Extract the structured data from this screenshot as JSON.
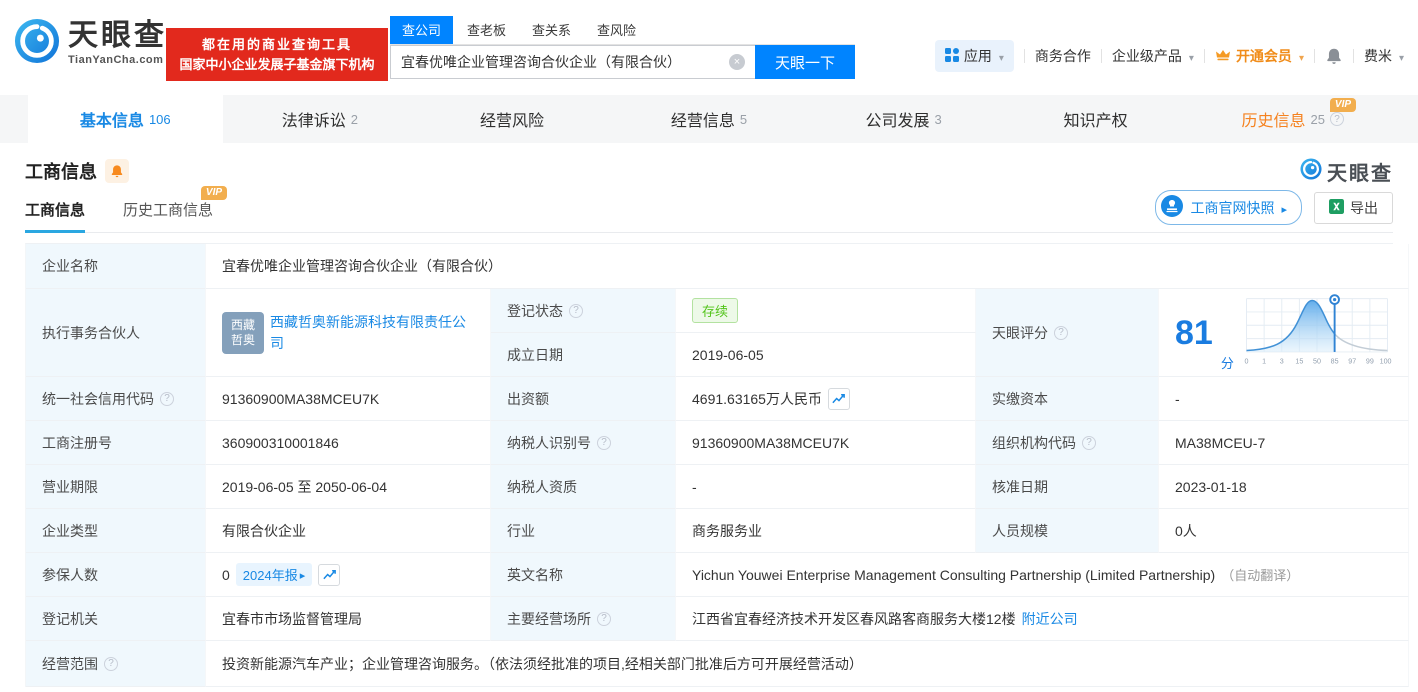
{
  "header": {
    "brand": {
      "name": "天眼查",
      "domain": "TianYanCha.com"
    },
    "slogan": {
      "line1": "都在用的商业查询工具",
      "line2": "国家中小企业发展子基金旗下机构"
    },
    "search": {
      "tabs": [
        {
          "label": "查公司"
        },
        {
          "label": "查老板"
        },
        {
          "label": "查关系"
        },
        {
          "label": "查风险"
        }
      ],
      "value": "宜春优唯企业管理咨询合伙企业（有限合伙）",
      "button": "天眼一下"
    },
    "nav": {
      "apps": "应用",
      "biz": "商务合作",
      "enterprise": "企业级产品",
      "vip": "开通会员",
      "user": "费米"
    }
  },
  "vip_label": "VIP",
  "tabs": [
    {
      "label": "基本信息",
      "count": "106"
    },
    {
      "label": "法律诉讼",
      "count": "2"
    },
    {
      "label": "经营风险",
      "count": ""
    },
    {
      "label": "经营信息",
      "count": "5"
    },
    {
      "label": "公司发展",
      "count": "3"
    },
    {
      "label": "知识产权",
      "count": ""
    },
    {
      "label": "历史信息",
      "count": "25"
    }
  ],
  "section": {
    "title": "工商信息",
    "watermark": "天眼查",
    "subtabs": [
      {
        "label": "工商信息"
      },
      {
        "label": "历史工商信息"
      }
    ],
    "snapshot_button": "工商官网快照",
    "export_button": "导出"
  },
  "company": {
    "name_label": "企业名称",
    "name": "宜春优唯企业管理咨询合伙企业（有限合伙）",
    "partner_label": "执行事务合伙人",
    "partner_avatar_line1": "西藏",
    "partner_avatar_line2": "哲奥",
    "partner_name": "西藏哲奥新能源科技有限责任公司",
    "status_label": "登记状态",
    "status": "存续",
    "established_label": "成立日期",
    "established": "2019-06-05",
    "score_label": "天眼评分",
    "credit_code_label": "统一社会信用代码",
    "credit_code": "91360900MA38MCEU7K",
    "capital_label": "出资额",
    "capital": "4691.63165万人民币",
    "paid_capital_label": "实缴资本",
    "paid_capital": "-",
    "reg_no_label": "工商注册号",
    "reg_no": "360900310001846",
    "taxpayer_id_label": "纳税人识别号",
    "taxpayer_id": "91360900MA38MCEU7K",
    "org_code_label": "组织机构代码",
    "org_code": "MA38MCEU-7",
    "term_label": "营业期限",
    "term": "2019-06-05 至 2050-06-04",
    "taxpayer_quality_label": "纳税人资质",
    "taxpayer_quality": "-",
    "approval_label": "核准日期",
    "approval": "2023-01-18",
    "type_label": "企业类型",
    "type": "有限合伙企业",
    "industry_label": "行业",
    "industry": "商务服务业",
    "staff_label": "人员规模",
    "staff": "0人",
    "insured_label": "参保人数",
    "insured": "0",
    "insured_report": "2024年报",
    "en_label": "英文名称",
    "en_name": "Yichun Youwei Enterprise Management Consulting Partnership (Limited Partnership)",
    "en_note": "（自动翻译）",
    "authority_label": "登记机关",
    "authority": "宜春市市场监督管理局",
    "address_label": "主要经营场所",
    "address": "江西省宜春经济技术开发区春风路客商服务大楼12楼",
    "nearby": "附近公司",
    "scope_label": "经营范围",
    "scope": "投资新能源汽车产业；企业管理咨询服务。（依法须经批准的项目,经相关部门批准后方可开展经营活动）"
  },
  "score_chart": {
    "score": "81",
    "unit": "分",
    "x_ticks": [
      "0",
      "1",
      "3",
      "15",
      "50",
      "85",
      "97",
      "99",
      "100"
    ]
  }
}
